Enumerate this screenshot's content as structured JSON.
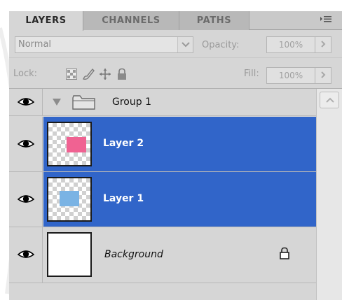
{
  "tabs": [
    {
      "label": "LAYERS",
      "active": true
    },
    {
      "label": "CHANNELS",
      "active": false
    },
    {
      "label": "PATHS",
      "active": false
    }
  ],
  "panel_menu_icon": "panel-menu-icon",
  "blend": {
    "mode": "Normal",
    "opacity_label": "Opacity:",
    "opacity_value": "100%"
  },
  "lock": {
    "label": "Lock:",
    "fill_label": "Fill:",
    "fill_value": "100%",
    "icons": [
      "lock-transparent-icon",
      "lock-image-icon",
      "lock-position-icon",
      "lock-all-icon"
    ]
  },
  "layers": [
    {
      "name": "Group 1",
      "type": "group",
      "visible": true,
      "selected": false
    },
    {
      "name": "Layer 2",
      "type": "layer",
      "visible": true,
      "selected": true,
      "swatch_color": "#f06292"
    },
    {
      "name": "Layer 1",
      "type": "layer",
      "visible": true,
      "selected": true,
      "swatch_color": "#7ab3e4"
    },
    {
      "name": "Background",
      "type": "background",
      "visible": true,
      "selected": false,
      "locked": true
    }
  ],
  "colors": {
    "selection": "#3165c9",
    "panel": "#d6d6d6"
  }
}
